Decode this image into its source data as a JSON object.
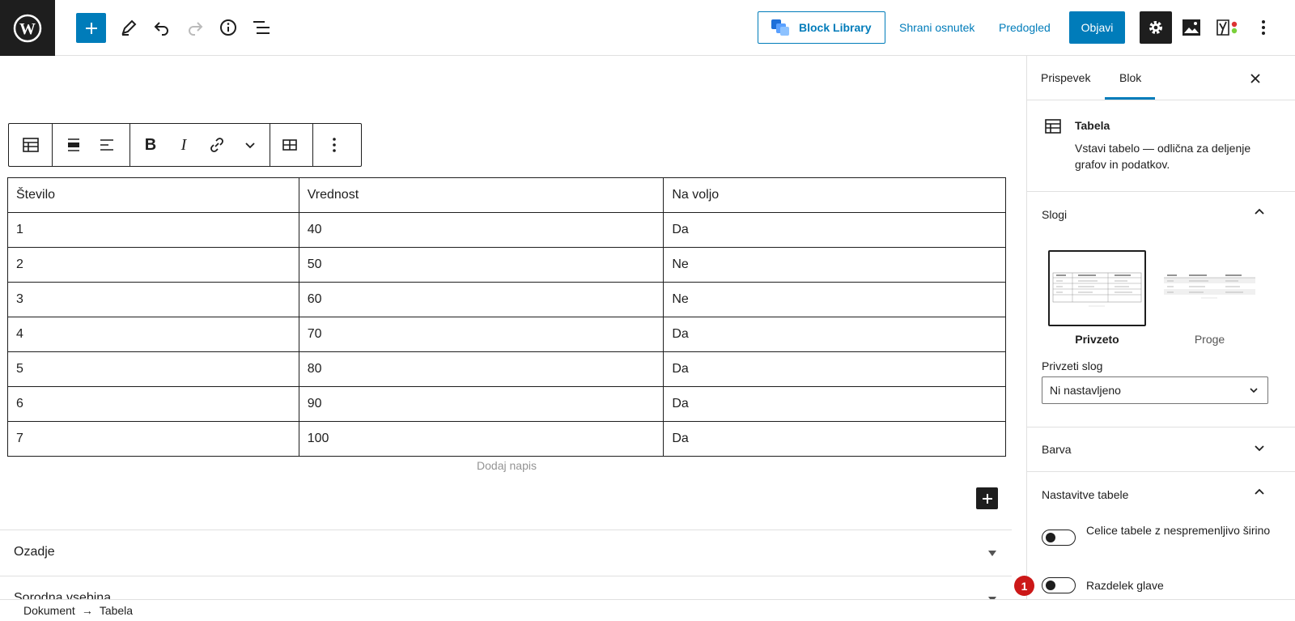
{
  "header": {
    "block_library": "Block Library",
    "save_draft": "Shrani osnutek",
    "preview": "Predogled",
    "publish": "Objavi"
  },
  "table": {
    "rows": [
      [
        "Število",
        "Vrednost",
        "Na voljo"
      ],
      [
        "1",
        "40",
        "Da"
      ],
      [
        "2",
        "50",
        "Ne"
      ],
      [
        "3",
        "60",
        "Ne"
      ],
      [
        "4",
        "70",
        "Da"
      ],
      [
        "5",
        "80",
        "Da"
      ],
      [
        "6",
        "90",
        "Da"
      ],
      [
        "7",
        "100",
        "Da"
      ]
    ],
    "caption_placeholder": "Dodaj napis"
  },
  "meta_boxes": [
    "Ozadje",
    "Sorodna vsebina"
  ],
  "breadcrumb": {
    "root": "Dokument",
    "arrow": "→",
    "current": "Tabela"
  },
  "sidebar": {
    "tabs": [
      "Prispevek",
      "Blok"
    ],
    "active_tab": "Blok",
    "block": {
      "name": "Tabela",
      "description": "Vstavi tabelo — odlična za deljenje grafov in podatkov."
    },
    "styles": {
      "title": "Slogi",
      "options": [
        "Privzeto",
        "Proge"
      ],
      "selected": "Privzeto",
      "default_style_label": "Privzeti slog",
      "default_style_value": "Ni nastavljeno"
    },
    "color": {
      "title": "Barva"
    },
    "table_settings": {
      "title": "Nastavitve tabele",
      "fixed_width_label": "Celice tabele z nespremenljivo širino",
      "header_section_label": "Razdelek glave"
    },
    "badge_number": "1"
  },
  "colors": {
    "accent": "#007cba",
    "dark": "#1e1e1e",
    "badge": "#cc1818"
  }
}
